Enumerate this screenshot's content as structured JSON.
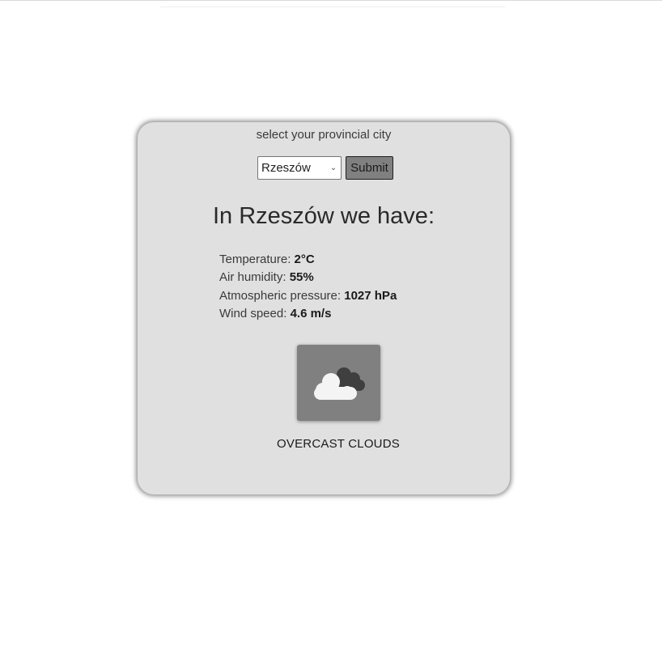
{
  "form": {
    "prompt": "select your provincial city",
    "selected_city": "Rzeszów",
    "submit_label": "Submit"
  },
  "weather": {
    "headline": "In Rzeszów we have:",
    "temperature_label": "Temperature:",
    "temperature_value": "2°C",
    "humidity_label": "Air humidity:",
    "humidity_value": "55%",
    "pressure_label": "Atmospheric pressure:",
    "pressure_value": "1027 hPa",
    "wind_label": "Wind speed:",
    "wind_value": "4.6 m/s",
    "icon": "overcast-clouds-icon",
    "description": "OVERCAST CLOUDS"
  },
  "colors": {
    "card_background": "#e0e0e0",
    "button_background": "#808080",
    "icon_background": "#808080"
  }
}
